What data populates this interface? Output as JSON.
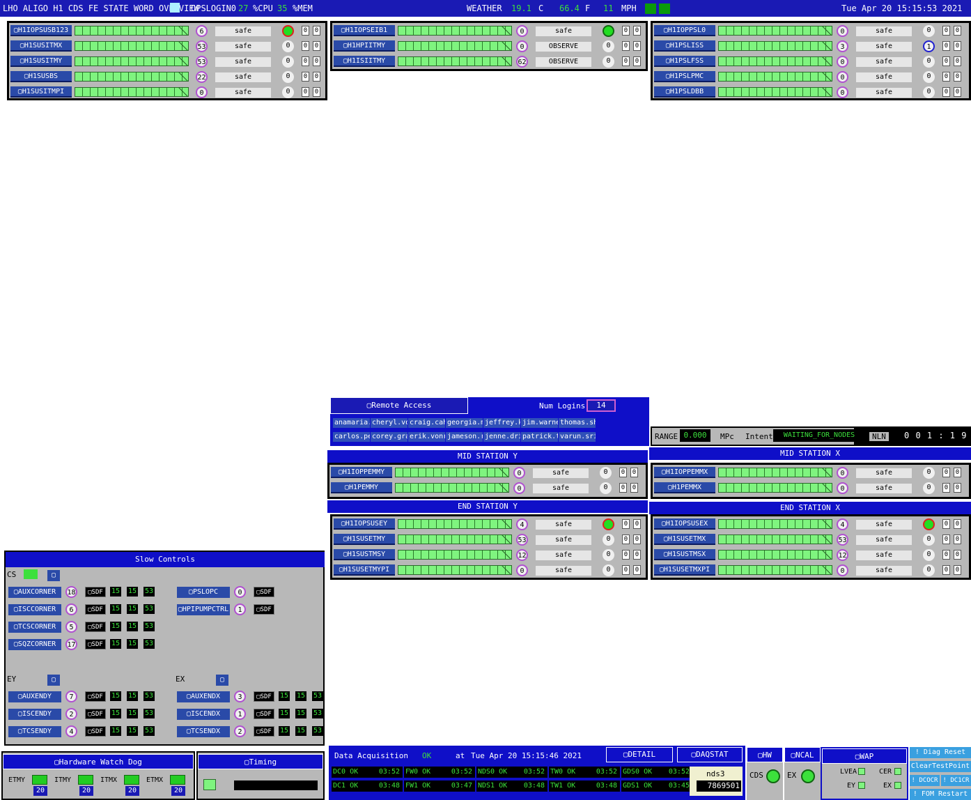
{
  "top": {
    "title": "LHO ALIGO H1 CDS FE STATE WORD OVERVIEW",
    "opslogin": "OPSLOGIN0",
    "cpu_val": "27",
    "cpu_lbl": "%CPU",
    "mem_val": "35",
    "mem_lbl": "%MEM",
    "weather": "WEATHER",
    "temp_c": "19.1",
    "c": "C",
    "temp_f": "66.4",
    "f": "F",
    "wind": "11",
    "mph": "MPH",
    "datetime": "Tue Apr 20 15:15:53 2021"
  },
  "states": {
    "safe": "safe",
    "observe": "OBSERVE"
  },
  "col1": [
    {
      "name": "H1IOPSUSB123",
      "n": "6",
      "state": "safe",
      "led": "r"
    },
    {
      "name": "H1SUSITMX",
      "n": "53",
      "state": "safe"
    },
    {
      "name": "H1SUSITMY",
      "n": "53",
      "state": "safe"
    },
    {
      "name": "H1SUSBS",
      "n": "22",
      "state": "safe"
    },
    {
      "name": "H1SUSITMPI",
      "n": "0",
      "state": "safe"
    }
  ],
  "col2": [
    {
      "name": "H1IOPSEIB1",
      "n": "0",
      "state": "safe",
      "led": "g"
    },
    {
      "name": "H1HPIITMY",
      "n": "0",
      "state": "OBSERVE"
    },
    {
      "name": "H1ISIITMY",
      "n": "62",
      "state": "OBSERVE"
    }
  ],
  "col3": [
    {
      "name": "H1IOPPSL0",
      "n": "0",
      "state": "safe"
    },
    {
      "name": "H1PSLISS",
      "n": "3",
      "state": "safe",
      "r": "1"
    },
    {
      "name": "H1PSLFSS",
      "n": "0",
      "state": "safe"
    },
    {
      "name": "H1PSLPMC",
      "n": "0",
      "state": "safe"
    },
    {
      "name": "H1PSLDBB",
      "n": "0",
      "state": "safe"
    }
  ],
  "remote": {
    "title": "Remote Access",
    "num_logins_lbl": "Num Logins",
    "num_logins": "14",
    "users1": [
      "anamaria.",
      "cheryl.vo",
      "craig.cah",
      "georgia.m",
      "jeffrey.k",
      "jim.warne",
      "thomas.sh"
    ],
    "users2": [
      "carlos.pe",
      "corey.gra",
      "erik.vonr",
      "jameson.r",
      "jenne.dri",
      "patrick.t",
      "varun.sri"
    ]
  },
  "range": {
    "lbl": "RANGE",
    "val": "0.000",
    "unit": "MPc",
    "intent_lbl": "Intent",
    "intent": "WAITING_FOR_NODES",
    "nln": "NLN",
    "clock": "0 0 1 : 1 9"
  },
  "mid_y": {
    "title": "MID STATION Y",
    "rows": [
      {
        "name": "H1IOPPEMMY",
        "n": "0",
        "state": "safe"
      },
      {
        "name": "H1PEMMY",
        "n": "0",
        "state": "safe"
      }
    ]
  },
  "mid_x": {
    "title": "MID STATION X",
    "rows": [
      {
        "name": "H1IOPPEMMX",
        "n": "0",
        "state": "safe"
      },
      {
        "name": "H1PEMMX",
        "n": "0",
        "state": "safe"
      }
    ]
  },
  "end_y": {
    "title": "END STATION Y",
    "rows": [
      {
        "name": "H1IOPSUSEY",
        "n": "4",
        "state": "safe",
        "led": "r"
      },
      {
        "name": "H1SUSETMY",
        "n": "53",
        "state": "safe"
      },
      {
        "name": "H1SUSTMSY",
        "n": "12",
        "state": "safe"
      },
      {
        "name": "H1SUSETMYPI",
        "n": "0",
        "state": "safe"
      }
    ]
  },
  "end_x": {
    "title": "END STATION X",
    "rows": [
      {
        "name": "H1IOPSUSEX",
        "n": "4",
        "state": "safe",
        "led": "r"
      },
      {
        "name": "H1SUSETMX",
        "n": "53",
        "state": "safe"
      },
      {
        "name": "H1SUSTMSX",
        "n": "12",
        "state": "safe"
      },
      {
        "name": "H1SUSETMXPI",
        "n": "0",
        "state": "safe"
      }
    ]
  },
  "slow": {
    "title": "Slow Controls",
    "cs": "CS",
    "ey": "EY",
    "ex": "EX",
    "sdf": "SDF",
    "cs_rows": [
      {
        "name": "AUXCORNER",
        "n": "18"
      },
      {
        "name": "ISCCORNER",
        "n": "6"
      },
      {
        "name": "TCSCORNER",
        "n": "5"
      },
      {
        "name": "SQZCORNER",
        "n": "17"
      }
    ],
    "cs_right": [
      {
        "name": "PSLOPC",
        "n": "0"
      },
      {
        "name": "HPIPUMPCTRL",
        "n": "1"
      }
    ],
    "ey_rows": [
      {
        "name": "AUXENDY",
        "n": "7"
      },
      {
        "name": "ISCENDY",
        "n": "2"
      },
      {
        "name": "TCSENDY",
        "n": "4"
      }
    ],
    "ex_rows": [
      {
        "name": "AUXENDX",
        "n": "3"
      },
      {
        "name": "ISCENDX",
        "n": "1"
      },
      {
        "name": "TCSENDX",
        "n": "2"
      }
    ],
    "g": "15",
    "g3": "53"
  },
  "hwd": {
    "title": "Hardware Watch Dog",
    "labels": [
      "ETMY",
      "ITMY",
      "ITMX",
      "ETMX"
    ],
    "vals": [
      "20",
      "20",
      "20",
      "20"
    ]
  },
  "timing": {
    "title": "Timing"
  },
  "daq": {
    "title": "Data Acquisition",
    "ok": "OK",
    "at": "at",
    "time": "Tue Apr 20 15:15:46 2021",
    "detail": "DETAIL",
    "daqstat": "DAQSTAT",
    "r1": [
      "DC0 OK",
      "03:52",
      "FW0 OK",
      "03:52",
      "NDS0 OK",
      "03:52",
      "TW0 OK",
      "03:52",
      "GDS0 OK",
      "03:52"
    ],
    "r2": [
      "DC1 OK",
      "03:48",
      "FW1 OK",
      "03:47",
      "NDS1 OK",
      "03:48",
      "TW1 OK",
      "03:48",
      "GDS1 OK",
      "03:45"
    ],
    "nds": "nds3",
    "nds_num": "7869501"
  },
  "btns": {
    "hw": "HW",
    "ncal": "NCAL",
    "cds": "CDS",
    "ex": "EX",
    "wap": "WAP",
    "lvea": "LVEA",
    "cer": "CER",
    "ey": "EY",
    "ex2": "EX",
    "diag": "! Diag Reset",
    "cleartp": "ClearTestPoint",
    "dcocr": "! DCOCR",
    "dc1cr": "! DC1CR",
    "fom": "! FOM Restart"
  }
}
